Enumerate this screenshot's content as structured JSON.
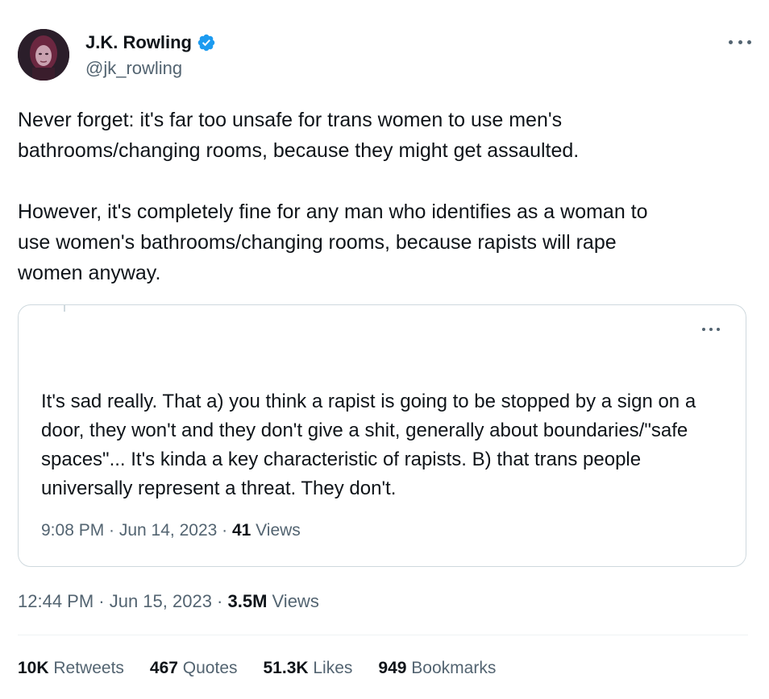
{
  "author": {
    "name": "J.K. Rowling",
    "handle": "@jk_rowling",
    "verified": true
  },
  "tweet": {
    "text": "Never forget: it's far too unsafe for trans women to use men's\nbathrooms/changing rooms, because they might get assaulted.\n\nHowever, it's completely fine for any man who identifies as a woman to\nuse women's bathrooms/changing rooms, because rapists will rape\nwomen anyway."
  },
  "quote": {
    "text": "It's sad really. That a) you think a rapist is going to be stopped by a sign on a door, they won't and they don't give a shit, generally about boundaries/\"safe spaces\"... It's kinda a key characteristic of rapists. B) that trans people universally represent a threat. They don't.",
    "time": "9:08 PM · Jun 14, 2023 · ",
    "views_count": "41",
    "views_label": " Views"
  },
  "meta": {
    "time": "12:44 PM · Jun 15, 2023 · ",
    "views_count": "3.5M",
    "views_label": " Views"
  },
  "stats": {
    "retweets_count": "10K",
    "retweets_label": " Retweets",
    "quotes_count": "467",
    "quotes_label": " Quotes",
    "likes_count": "51.3K",
    "likes_label": " Likes",
    "bookmarks_count": "949",
    "bookmarks_label": " Bookmarks"
  },
  "colors": {
    "verified": "#1d9bf0",
    "muted_text": "#536471",
    "border": "#cfd9de"
  },
  "icons": {
    "verified": "verified-badge-icon",
    "more": "more-options-icon"
  }
}
